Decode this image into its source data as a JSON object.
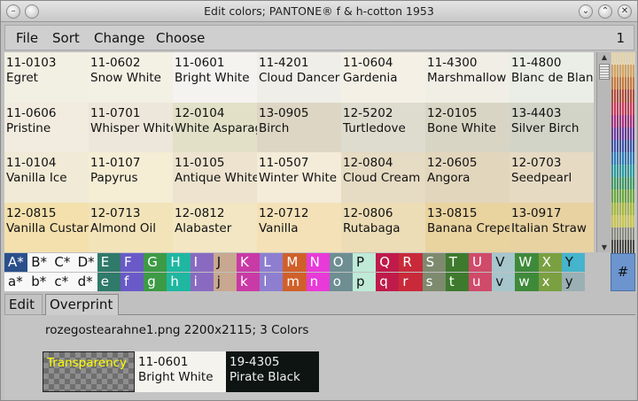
{
  "window": {
    "title": "Edit colors; PANTONE® f & h-cotton 1953",
    "controls": [
      "chevron-down-icon",
      "chevron-up-icon",
      "close-icon"
    ]
  },
  "menubar": {
    "items": [
      "File",
      "Sort",
      "Change",
      "Choose"
    ],
    "page": "1"
  },
  "colors": [
    [
      {
        "code": "11-0103",
        "name": "Egret",
        "bg": "#f2efe3"
      },
      {
        "code": "11-0602",
        "name": "Snow White",
        "bg": "#f3f0e4"
      },
      {
        "code": "11-0601",
        "name": "Bright White",
        "bg": "#f4f3ef"
      },
      {
        "code": "11-4201",
        "name": "Cloud Dancer",
        "bg": "#f0eee8"
      },
      {
        "code": "11-0604",
        "name": "Gardenia",
        "bg": "#f4f0e6"
      },
      {
        "code": "11-4300",
        "name": "Marshmallow",
        "bg": "#f0eee5"
      },
      {
        "code": "11-4800",
        "name": "Blanc de Blanc",
        "bg": "#ebeee6"
      }
    ],
    [
      {
        "code": "11-0606",
        "name": "Pristine",
        "bg": "#f2ece0"
      },
      {
        "code": "11-0701",
        "name": "Whisper White",
        "bg": "#ede6da"
      },
      {
        "code": "12-0104",
        "name": "White Asparagus",
        "bg": "#e2e1c8"
      },
      {
        "code": "13-0905",
        "name": "Birch",
        "bg": "#ddd6c4"
      },
      {
        "code": "12-5202",
        "name": "Turtledove",
        "bg": "#dedbcf"
      },
      {
        "code": "12-0105",
        "name": "Bone White",
        "bg": "#d9d5c4"
      },
      {
        "code": "13-4403",
        "name": "Silver Birch",
        "bg": "#d3d4c8"
      }
    ],
    [
      {
        "code": "11-0104",
        "name": "Vanilla Ice",
        "bg": "#f0ead6"
      },
      {
        "code": "11-0107",
        "name": "Papyrus",
        "bg": "#f5edd4"
      },
      {
        "code": "11-0105",
        "name": "Antique White",
        "bg": "#ede3cf"
      },
      {
        "code": "11-0507",
        "name": "Winter White",
        "bg": "#f4ebd8"
      },
      {
        "code": "12-0804",
        "name": "Cloud Cream",
        "bg": "#e6dbc3"
      },
      {
        "code": "12-0605",
        "name": "Angora",
        "bg": "#e2d6bd"
      },
      {
        "code": "12-0703",
        "name": "Seedpearl",
        "bg": "#e6dac3"
      }
    ],
    [
      {
        "code": "12-0815",
        "name": "Vanilla Custard",
        "bg": "#f3e0ac"
      },
      {
        "code": "12-0713",
        "name": "Almond Oil",
        "bg": "#f3e3b9"
      },
      {
        "code": "12-0812",
        "name": "Alabaster",
        "bg": "#f2e6c3"
      },
      {
        "code": "12-0712",
        "name": "Vanilla",
        "bg": "#f4e1b8"
      },
      {
        "code": "12-0806",
        "name": "Rutabaga",
        "bg": "#ecddb6"
      },
      {
        "code": "13-0815",
        "name": "Banana Crepe",
        "bg": "#e9d39f"
      },
      {
        "code": "13-0917",
        "name": "Italian Straw",
        "bg": "#e8d2a2"
      }
    ]
  ],
  "palette_strip": [
    "#e9d6a6",
    "#d6a35a",
    "#c77a3a",
    "#b24d3b",
    "#c93a5b",
    "#a3307e",
    "#6b3d9c",
    "#3d55a8",
    "#2e7ab8",
    "#2a9a9e",
    "#3e9a64",
    "#6aa83c",
    "#a6b83a",
    "#c9c54a",
    "#8a8a80",
    "#4a4a46"
  ],
  "letters_upper": [
    {
      "label": "A*",
      "bg": "#2a4f8a",
      "fg": "#ffffff"
    },
    {
      "label": "B*",
      "bg": "#f8f8f8",
      "fg": "#111111"
    },
    {
      "label": "C*",
      "bg": "#f8f8f8",
      "fg": "#111111"
    },
    {
      "label": "D*",
      "bg": "#f8f8f8",
      "fg": "#111111"
    },
    {
      "label": "E",
      "bg": "#2f7a6a",
      "fg": "#ffffff"
    },
    {
      "label": "F",
      "bg": "#6a5ac8",
      "fg": "#ffffff"
    },
    {
      "label": "G",
      "bg": "#3d9a45",
      "fg": "#ffffff"
    },
    {
      "label": "H",
      "bg": "#1fb7a0",
      "fg": "#ffffff"
    },
    {
      "label": "I",
      "bg": "#8a6ac0",
      "fg": "#ffffff"
    },
    {
      "label": "J",
      "bg": "#c8a890",
      "fg": "#111111"
    },
    {
      "label": "K",
      "bg": "#c93aa6",
      "fg": "#ffffff"
    },
    {
      "label": "L",
      "bg": "#8e7ed0",
      "fg": "#ffffff"
    },
    {
      "label": "M",
      "bg": "#d0602a",
      "fg": "#ffffff"
    },
    {
      "label": "N",
      "bg": "#e83ad8",
      "fg": "#ffffff"
    },
    {
      "label": "O",
      "bg": "#6e8e92",
      "fg": "#ffffff"
    },
    {
      "label": "P",
      "bg": "#bfead8",
      "fg": "#111111"
    },
    {
      "label": "Q",
      "bg": "#c01a4a",
      "fg": "#ffffff"
    },
    {
      "label": "R",
      "bg": "#c82a3a",
      "fg": "#ffffff"
    },
    {
      "label": "S",
      "bg": "#7e8a6e",
      "fg": "#ffffff"
    },
    {
      "label": "T",
      "bg": "#3e7a2e",
      "fg": "#ffffff"
    },
    {
      "label": "U",
      "bg": "#d04a6a",
      "fg": "#ffffff"
    },
    {
      "label": "V",
      "bg": "#a6c6cc",
      "fg": "#111111"
    },
    {
      "label": "W",
      "bg": "#3e8a3a",
      "fg": "#ffffff"
    },
    {
      "label": "X",
      "bg": "#7aa042",
      "fg": "#ffffff"
    },
    {
      "label": "Y",
      "bg": "#46b4cc",
      "fg": "#111111"
    },
    {
      "label": "",
      "bg": "#c0c0c0",
      "fg": "#111111"
    }
  ],
  "letters_lower": [
    {
      "label": "a*",
      "bg": "#f8f8f8",
      "fg": "#111111"
    },
    {
      "label": "b*",
      "bg": "#f8f8f8",
      "fg": "#111111"
    },
    {
      "label": "c*",
      "bg": "#f8f8f8",
      "fg": "#111111"
    },
    {
      "label": "d*",
      "bg": "#f8f8f8",
      "fg": "#111111"
    },
    {
      "label": "e",
      "bg": "#2f7a6a",
      "fg": "#ffffff"
    },
    {
      "label": "f",
      "bg": "#6a5ac8",
      "fg": "#ffffff"
    },
    {
      "label": "g",
      "bg": "#3d9a45",
      "fg": "#ffffff"
    },
    {
      "label": "h",
      "bg": "#1fb7a0",
      "fg": "#ffffff"
    },
    {
      "label": "i",
      "bg": "#8a6ac0",
      "fg": "#ffffff"
    },
    {
      "label": "j",
      "bg": "#c8a890",
      "fg": "#111111"
    },
    {
      "label": "k",
      "bg": "#c93aa6",
      "fg": "#ffffff"
    },
    {
      "label": "l",
      "bg": "#8e7ed0",
      "fg": "#ffffff"
    },
    {
      "label": "m",
      "bg": "#d0602a",
      "fg": "#ffffff"
    },
    {
      "label": "n",
      "bg": "#e83ad8",
      "fg": "#ffffff"
    },
    {
      "label": "o",
      "bg": "#6e8e92",
      "fg": "#ffffff"
    },
    {
      "label": "p",
      "bg": "#bfead8",
      "fg": "#111111"
    },
    {
      "label": "q",
      "bg": "#c01a4a",
      "fg": "#ffffff"
    },
    {
      "label": "r",
      "bg": "#c82a3a",
      "fg": "#ffffff"
    },
    {
      "label": "s",
      "bg": "#7e8a6e",
      "fg": "#ffffff"
    },
    {
      "label": "t",
      "bg": "#3e7a2e",
      "fg": "#ffffff"
    },
    {
      "label": "u",
      "bg": "#d04a6a",
      "fg": "#ffffff"
    },
    {
      "label": "v",
      "bg": "#a6c6cc",
      "fg": "#111111"
    },
    {
      "label": "w",
      "bg": "#3e8a3a",
      "fg": "#ffffff"
    },
    {
      "label": "x",
      "bg": "#7aa042",
      "fg": "#ffffff"
    },
    {
      "label": "y",
      "bg": "#9ab0b4",
      "fg": "#111111"
    },
    {
      "label": "",
      "bg": "#c0c0c0",
      "fg": "#111111"
    }
  ],
  "hash_button": "#",
  "tabs": {
    "edit": "Edit",
    "overprint": "Overprint"
  },
  "overprint": {
    "file_info": "rozegostearahne1.png 2200x2115; 3 Colors",
    "swatches": {
      "transparency": {
        "label": "Transparency",
        "color": "#ffff00"
      },
      "white": {
        "code": "11-0601",
        "name": "Bright White"
      },
      "black": {
        "code": "19-4305",
        "name": "Pirate Black"
      }
    }
  }
}
